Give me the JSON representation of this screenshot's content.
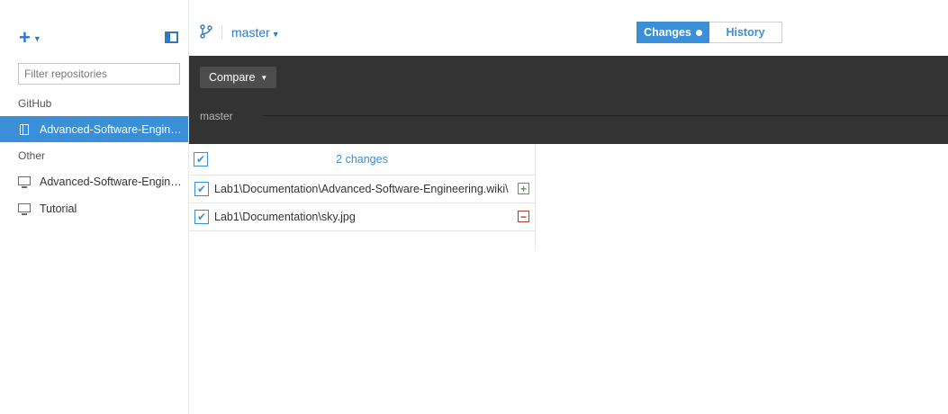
{
  "sidebar": {
    "add_icon": "plus-icon",
    "filter_placeholder": "Filter repositories",
    "groups": [
      {
        "label": "GitHub",
        "repos": [
          {
            "label": "Advanced-Software-Enginee...",
            "icon": "repo-book-icon",
            "selected": true
          }
        ]
      },
      {
        "label": "Other",
        "repos": [
          {
            "label": "Advanced-Software-Enginee...",
            "icon": "monitor-icon",
            "selected": false
          },
          {
            "label": "Tutorial",
            "icon": "monitor-icon",
            "selected": false
          }
        ]
      }
    ]
  },
  "header": {
    "branch": "master",
    "tabs": [
      {
        "label": "Changes",
        "active": true
      },
      {
        "label": "History",
        "active": false
      }
    ]
  },
  "toolbar": {
    "compare_label": "Compare",
    "timeline_branch": "master"
  },
  "changes": {
    "count_label": "2 changes",
    "files": [
      {
        "path": "Lab1\\Documentation\\Advanced-Software-Engineering.wiki\\",
        "status": "added"
      },
      {
        "path": "Lab1\\Documentation\\sky.jpg",
        "status": "removed"
      }
    ]
  },
  "colors": {
    "accent": "#3a8fd6",
    "dark_bar": "#333333",
    "added": "#4fa33b",
    "removed": "#b33a2b"
  }
}
